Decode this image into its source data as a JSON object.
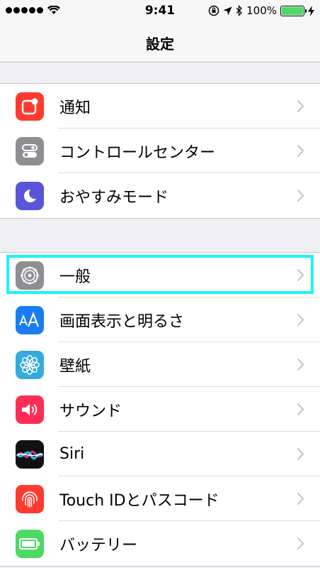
{
  "status_bar": {
    "time": "9:41",
    "battery_percent": "100%"
  },
  "nav": {
    "title": "設定"
  },
  "groups": [
    {
      "rows": [
        {
          "label": "通知",
          "icon": "notifications-icon",
          "color": "#fe3b30"
        },
        {
          "label": "コントロールセンター",
          "icon": "control-center-icon",
          "color": "#8e8e93"
        },
        {
          "label": "おやすみモード",
          "icon": "moon-icon",
          "color": "#5856d6"
        }
      ]
    },
    {
      "rows": [
        {
          "label": "一般",
          "icon": "gear-icon",
          "color": "#8e8e93"
        },
        {
          "label": "画面表示と明るさ",
          "icon": "display-icon",
          "color": "#1a7cf5"
        },
        {
          "label": "壁紙",
          "icon": "wallpaper-icon",
          "color": "#35aadc"
        },
        {
          "label": "サウンド",
          "icon": "sound-icon",
          "color": "#fe2d55"
        },
        {
          "label": "Siri",
          "icon": "siri-icon",
          "color": "#111111"
        },
        {
          "label": "Touch IDとパスコード",
          "icon": "fingerprint-icon",
          "color": "#fe3b30"
        },
        {
          "label": "バッテリー",
          "icon": "battery-icon",
          "color": "#4cd964"
        }
      ]
    }
  ]
}
